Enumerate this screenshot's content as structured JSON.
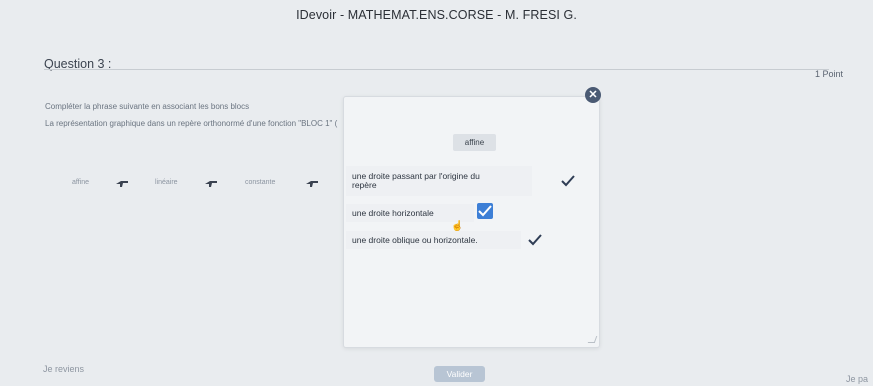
{
  "header": {
    "title": "IDevoir - MATHEMAT.ENS.CORSE - M. FRESI G."
  },
  "question": {
    "title": "Question 3 :",
    "points": "1 Point",
    "instruction": "Compléter la phrase suivante en associant les bons blocs",
    "sentence_start": "La représentation graphique dans un repère orthonormé d'une fonction \"BLOC 1\" ("
  },
  "popup": {
    "selected_chip": "affine",
    "options": [
      {
        "line1": "une droite passant par l'origine du",
        "line2": "repère"
      },
      {
        "line1": "une droite horizontale"
      },
      {
        "line1": "une droite oblique ou horizontale."
      }
    ],
    "colors": {
      "check_dark": "#2f3d55",
      "check_blue": "#3d7fd6",
      "close_bg": "#4a5a73"
    }
  },
  "chips": [
    {
      "label": "affine"
    },
    {
      "label": "linéaire"
    },
    {
      "label": "constante"
    }
  ],
  "footer": {
    "left": "Je reviens",
    "center": "Valider",
    "right": "Je pa"
  }
}
